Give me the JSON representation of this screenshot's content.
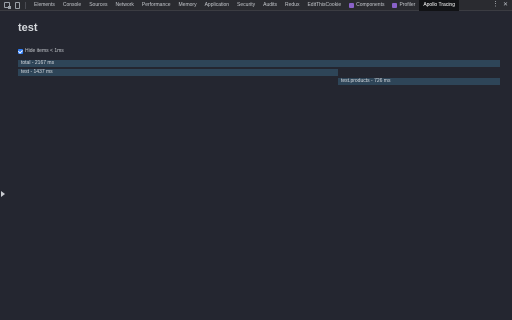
{
  "toolbar": {
    "tabs": [
      {
        "label": "Elements",
        "active": false,
        "react": false
      },
      {
        "label": "Console",
        "active": false,
        "react": false
      },
      {
        "label": "Sources",
        "active": false,
        "react": false
      },
      {
        "label": "Network",
        "active": false,
        "react": false
      },
      {
        "label": "Performance",
        "active": false,
        "react": false
      },
      {
        "label": "Memory",
        "active": false,
        "react": false
      },
      {
        "label": "Application",
        "active": false,
        "react": false
      },
      {
        "label": "Security",
        "active": false,
        "react": false
      },
      {
        "label": "Audits",
        "active": false,
        "react": false
      },
      {
        "label": "Redux",
        "active": false,
        "react": false
      },
      {
        "label": "EditThisCookie",
        "active": false,
        "react": false
      },
      {
        "label": "Components",
        "active": false,
        "react": true
      },
      {
        "label": "Profiler",
        "active": false,
        "react": true
      },
      {
        "label": "Apollo Tracing",
        "active": true,
        "react": false
      }
    ],
    "more_glyph": "⋮",
    "close_glyph": "✕",
    "icons": {
      "inspect": "inspect-element-icon",
      "device": "device-toolbar-icon",
      "react": "react-logo-icon"
    }
  },
  "panel": {
    "title": "test",
    "filter": {
      "label": "Hide items < 1ms",
      "checked": true
    },
    "traces": [
      {
        "label": "total - 2167 ms"
      },
      {
        "label": "test - 1437 ms"
      },
      {
        "label": "test.products - 726 ms"
      }
    ]
  },
  "colors": {
    "background": "#242630",
    "toolbar": "#2a2b30",
    "active_tab": "#111215",
    "bar": "#2e4558",
    "checkbox": "#2f7cf6"
  }
}
